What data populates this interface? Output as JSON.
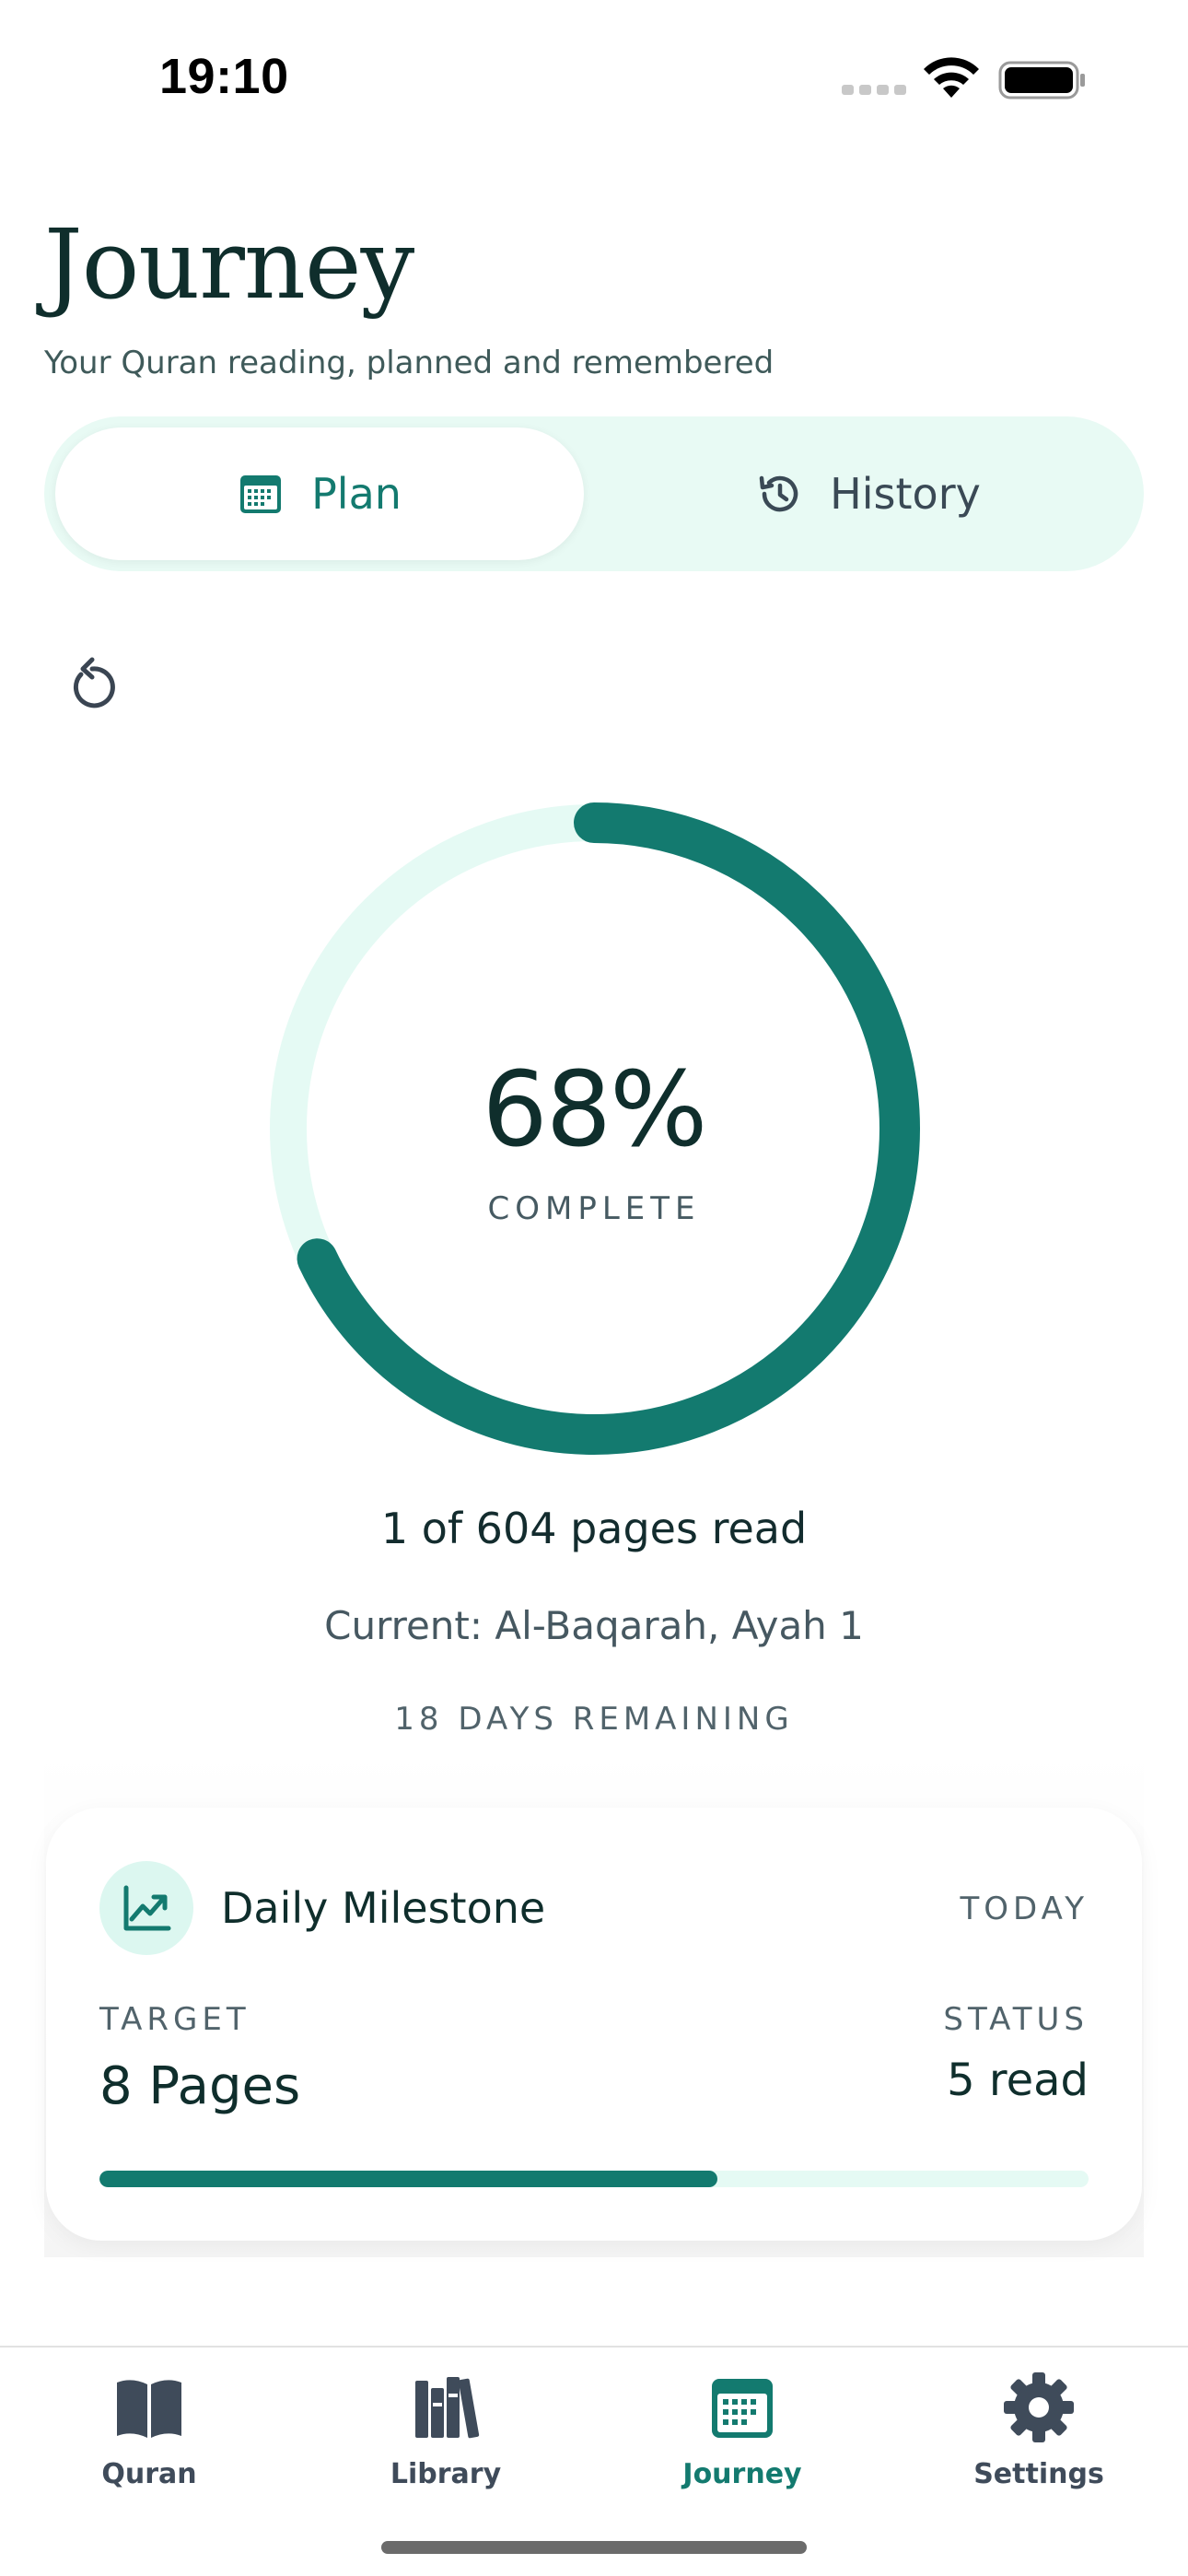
{
  "status_bar": {
    "time": "19:10"
  },
  "header": {
    "title": "Journey",
    "subtitle": "Your Quran reading, planned and remembered"
  },
  "segmented": {
    "tabs": [
      {
        "label": "Plan",
        "icon": "calendar-icon",
        "active": true
      },
      {
        "label": "History",
        "icon": "history-icon",
        "active": false
      }
    ]
  },
  "progress": {
    "percent_text": "68%",
    "percent_value": 0.68,
    "caption": "COMPLETE",
    "pages_read": "1 of 604 pages read",
    "current": "Current: Al-Baqarah, Ayah 1",
    "days_remaining": "18 DAYS REMAINING"
  },
  "milestone": {
    "icon": "trend-chart-icon",
    "title": "Daily Milestone",
    "when": "TODAY",
    "target_label": "TARGET",
    "target_value": "8 Pages",
    "status_label": "STATUS",
    "status_value": "5 read",
    "fill_fraction": 0.625
  },
  "tab_bar": {
    "items": [
      {
        "label": "Quran",
        "icon": "book-icon",
        "active": false
      },
      {
        "label": "Library",
        "icon": "books-icon",
        "active": false
      },
      {
        "label": "Journey",
        "icon": "calendar-icon",
        "active": true
      },
      {
        "label": "Settings",
        "icon": "gear-icon",
        "active": false
      }
    ]
  },
  "colors": {
    "accent": "#137a6f",
    "track": "#e5faf4",
    "segment_bg": "#e8faf4",
    "text_dark": "#0f2e2c",
    "tab_inactive": "#3f4b5a"
  }
}
